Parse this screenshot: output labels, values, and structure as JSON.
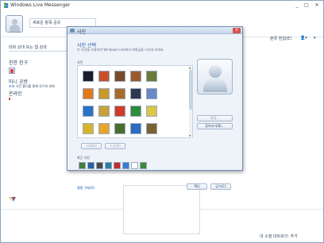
{
  "window": {
    "title": "Windows Live Messenger",
    "controls": [
      "_",
      "□",
      "✕"
    ]
  },
  "profile": {
    "status_message": "새로운 항목 공유"
  },
  "search": {
    "placeholder": "대화 상대 또는 웹 검색"
  },
  "groups": [
    {
      "label": "친한 친구"
    },
    {
      "label": "미니 공방"
    },
    {
      "label": "온라인"
    }
  ],
  "invite": {
    "link": "초대",
    "text": "사진 폴더를 통해 친구와 대화"
  },
  "toolbar": {
    "options_label": "분류 편집(E)",
    "icons": [
      "👤▾",
      "▾"
    ]
  },
  "statusbar": {
    "right_text": "내 소셜 네트워크: 추가"
  },
  "dialog": {
    "title": "사진",
    "close": "✕",
    "heading": "사진 선택",
    "description": "이 사진을 사용하여 Windows Live에서 회원님을 나타내 보세요.",
    "section_pictures": "사진",
    "section_recent": "최근 사진",
    "delete_button": "삭제(D)",
    "edit_button": "수정(M)",
    "webcam_button": "웹캠...",
    "browse_button": "찾아보기(B)...",
    "link": "웹캠 구매(D)",
    "ok_button": "확인",
    "cancel_button": "닫기(C)",
    "tile_colors": [
      "#1a1f2b",
      "#c7512b",
      "#7a4b2a",
      "#9c5a2c",
      "#6b7c3a",
      "#e07a1b",
      "#c79a2b",
      "#a86b2a",
      "#2d3a52",
      "#6a87c6",
      "#2a73c4",
      "#c9a13b",
      "#d23b2b",
      "#2f8c3e",
      "#d9c64a",
      "#d6b429",
      "#e8a628",
      "#4a6e2c",
      "#2e6bc2",
      "#7b6230"
    ],
    "recent_colors": [
      "#3f7f3a",
      "#2a5fa8",
      "#4a4a4a",
      "#2a7fa0",
      "#c42a2a",
      "#3a7ad1",
      "#ffffff",
      "#3a8a3a"
    ]
  }
}
